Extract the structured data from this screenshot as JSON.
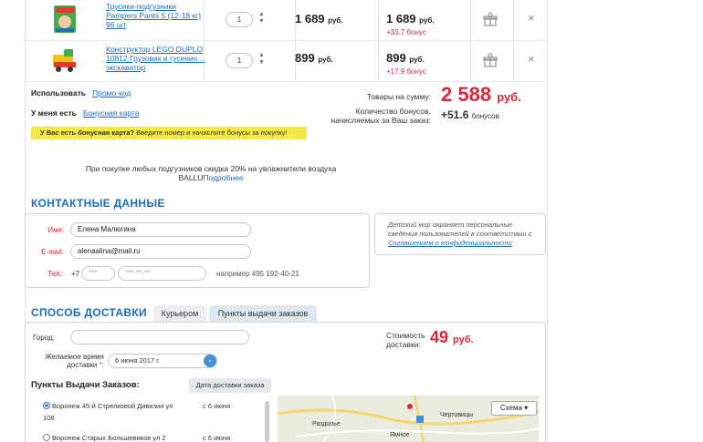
{
  "cart": {
    "items": [
      {
        "name": "Трусики-подгузники Pampers Pants 5 (12-18 кг) 96 шт",
        "qty": "1",
        "price": "1 689",
        "price_unit": "руб.",
        "total": "1 689",
        "total_unit": "руб.",
        "bonus": "+33.7 бонус"
      },
      {
        "name": "Конструктор LEGO DUPLO 10812 Грузовик и гусенич… экскаватор",
        "qty": "1",
        "price": "899",
        "price_unit": "руб.",
        "total": "899",
        "total_unit": "руб.",
        "bonus": "+17.9 бонус"
      }
    ],
    "remove_symbol": "×"
  },
  "promo": {
    "use_label": "Использовать",
    "promo_link": "Промо-код",
    "have_label": "У меня есть",
    "bonus_card_link": "Бонусная карта",
    "bar_bold": "У Вас есть бонусная карта?",
    "bar_text": " Введите номер и начислите бонусы за покупку!"
  },
  "summary": {
    "sum_label": "Товары на сумму:",
    "sum_value": "2 588",
    "sum_unit": "руб.",
    "bonus_label_1": "Количество бонусов,",
    "bonus_label_2": "начисляемых за Ваш заказ:",
    "bonus_value": "+51.6",
    "bonus_unit": "бонусов"
  },
  "offer": {
    "text_1": "При покупке любых подгузников скидка 20% на увлажнители воздуха",
    "text_2": "BALLU",
    "link": "Подробнее"
  },
  "contacts": {
    "title": "КОНТАКТНЫЕ ДАННЫЕ",
    "name_label": "Имя:",
    "name_value": "Елена Малюгина",
    "email_label": "E-mail:",
    "email_value": "alenaalina@mail.ru",
    "phone_label": "Тел.:",
    "phone_prefix": "+7",
    "phone_code_ph": "***",
    "phone_num_ph": "***-**-**",
    "phone_hint": "например 495 192-40-21",
    "privacy_1": "Детский мир охраняет персональные сведения пользователей в соответствии с ",
    "privacy_link": "Соглашением о конфиденциальности"
  },
  "delivery": {
    "title": "СПОСОБ ДОСТАВКИ",
    "tab_courier": "Курьером",
    "tab_pickup": "Пункты выдачи заказов",
    "city_label": "Город:",
    "time_label_1": "Желаемое время",
    "time_label_2": "доставки",
    "time_required": "*:",
    "date_value": "6 июня 2017 г.",
    "cost_label_1": "Стоимость",
    "cost_label_2": "доставки:",
    "cost_value": "49",
    "cost_unit": "руб.",
    "pickup_title": "Пункты Выдачи Заказов:",
    "date_btn": "Дата доставки заказа",
    "points": [
      {
        "line1": "Воронеж 45-й Стрелковой Дивизии ул",
        "line2": "108",
        "when": "с 6 июня"
      },
      {
        "line1": "Воронеж Старых Большевиков ул 2",
        "line2": "",
        "when": "с 6 июня"
      }
    ],
    "scheme_btn": "Схема ▾",
    "map_labels": [
      "Раздолье",
      "Чертовицы",
      "Ямное"
    ]
  }
}
